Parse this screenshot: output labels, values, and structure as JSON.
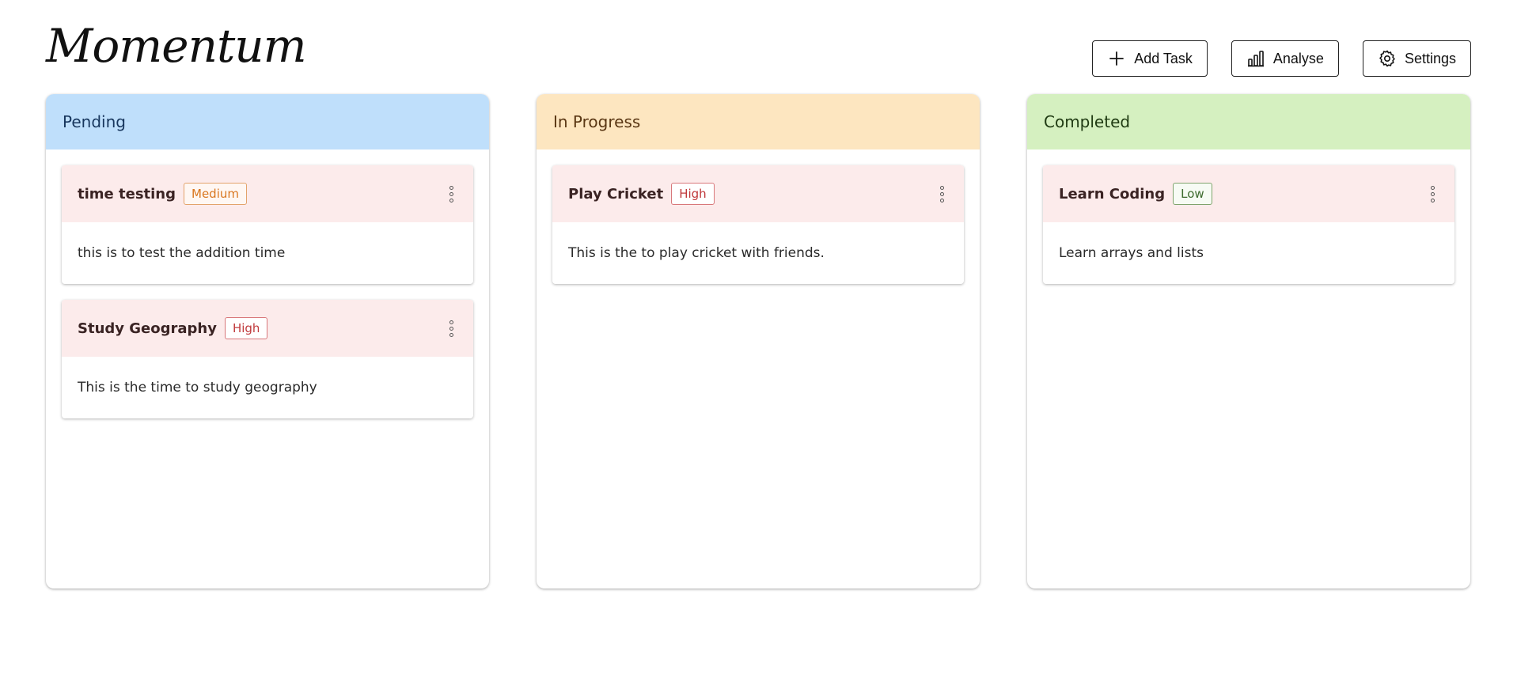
{
  "app": {
    "title": "Momentum"
  },
  "toolbar": {
    "add_task": {
      "label": "Add Task",
      "icon": "plus-icon"
    },
    "analyse": {
      "label": "Analyse",
      "icon": "bar-chart-icon"
    },
    "settings": {
      "label": "Settings",
      "icon": "gear-icon"
    }
  },
  "colors": {
    "pending_header": "#bfdffb",
    "pending_text": "#17365d",
    "inprogress_header": "#fde6c0",
    "inprogress_text": "#5a3714",
    "completed_header": "#d5f0c0",
    "completed_text": "#1f3a12",
    "card_header": "#fcebeb"
  },
  "columns": [
    {
      "title": "Pending",
      "cards": [
        {
          "title": "time testing",
          "priority": "Medium",
          "description": "this is to test the addition time"
        },
        {
          "title": "Study Geography",
          "priority": "High",
          "description": "This is the time to study geography"
        }
      ]
    },
    {
      "title": "In Progress",
      "cards": [
        {
          "title": "Play Cricket",
          "priority": "High",
          "description": "This is the to play cricket with friends."
        }
      ]
    },
    {
      "title": "Completed",
      "cards": [
        {
          "title": "Learn Coding",
          "priority": "Low",
          "description": "Learn arrays and lists"
        }
      ]
    }
  ]
}
